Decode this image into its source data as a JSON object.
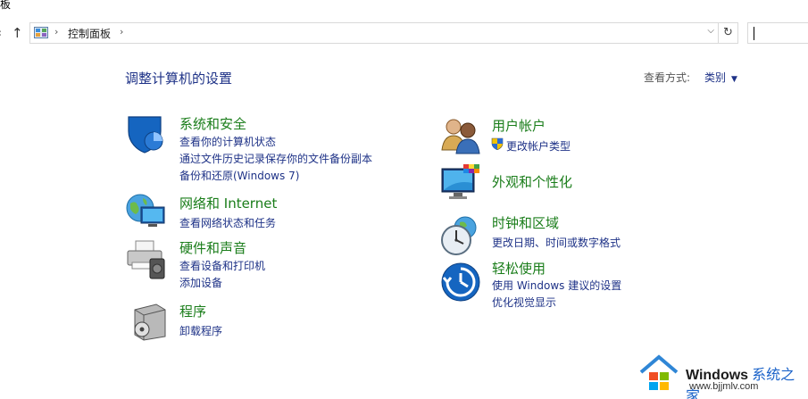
{
  "window": {
    "title_fragment": "板"
  },
  "nav": {
    "back_icon": "back-arrow-icon",
    "up_icon": "up-arrow-icon",
    "breadcrumb": "控制面板",
    "refresh_icon": "refresh-icon",
    "dropdown_icon": "chevron-down-icon"
  },
  "header": {
    "title": "调整计算机的设置",
    "view_by_label": "查看方式:",
    "view_by_value": "类别"
  },
  "categories": {
    "security": {
      "title": "系统和安全",
      "links": [
        "查看你的计算机状态",
        "通过文件历史记录保存你的文件备份副本",
        "备份和还原(Windows 7)"
      ],
      "icon": "shield-icon"
    },
    "network": {
      "title": "网络和 Internet",
      "links": [
        "查看网络状态和任务"
      ],
      "icon": "globe-network-icon"
    },
    "hardware": {
      "title": "硬件和声音",
      "links": [
        "查看设备和打印机",
        "添加设备"
      ],
      "icon": "printer-icon"
    },
    "programs": {
      "title": "程序",
      "links": [
        "卸载程序"
      ],
      "icon": "programs-box-icon"
    },
    "users": {
      "title": "用户帐户",
      "links": [
        "更改帐户类型"
      ],
      "icon": "users-icon"
    },
    "appearance": {
      "title": "外观和个性化",
      "links": [],
      "icon": "monitor-palette-icon"
    },
    "clock": {
      "title": "时钟和区域",
      "links": [
        "更改日期、时间或数字格式"
      ],
      "icon": "clock-globe-icon"
    },
    "ease": {
      "title": "轻松使用",
      "links": [
        "使用 Windows 建议的设置",
        "优化视觉显示"
      ],
      "icon": "ease-of-access-icon"
    }
  },
  "watermark": {
    "brand": "Windows",
    "cn": "系统之家",
    "url": "www.bjjmlv.com"
  },
  "colors": {
    "title_blue": "#1e3287",
    "category_green": "#1a7d1a",
    "link_blue": "#1e3287"
  }
}
